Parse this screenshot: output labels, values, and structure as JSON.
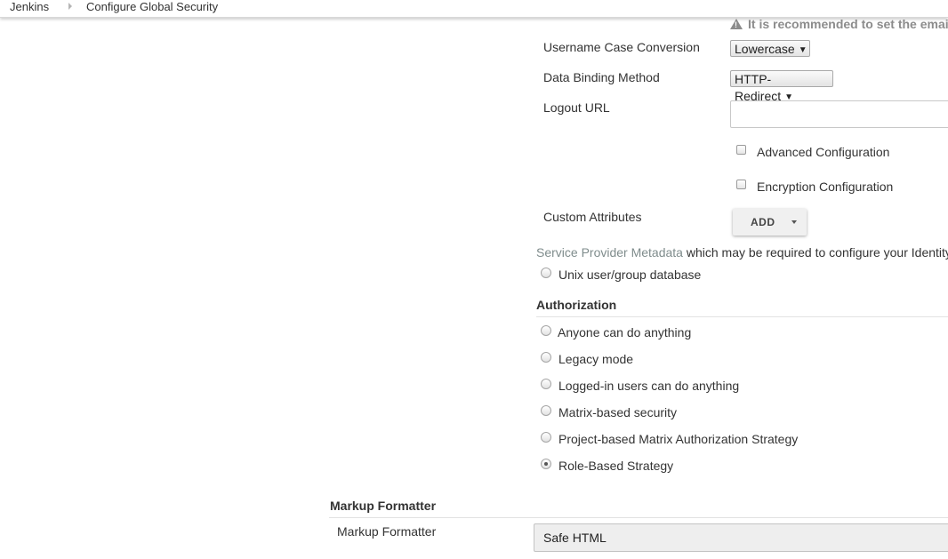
{
  "breadcrumb": {
    "root": "Jenkins",
    "current": "Configure Global Security"
  },
  "saml": {
    "warning": "It is recommended to set the emai",
    "username_case": {
      "label": "Username Case Conversion",
      "value": "Lowercase"
    },
    "binding": {
      "label": "Data Binding Method",
      "value": "HTTP-Redirect"
    },
    "logout_url": {
      "label": "Logout URL",
      "value": "",
      "placeholder": ""
    },
    "advanced_config": {
      "label": "Advanced Configuration",
      "checked": false
    },
    "encryption_config": {
      "label": "Encryption Configuration",
      "checked": false
    },
    "custom_attributes": {
      "label": "Custom Attributes",
      "button": "ADD"
    },
    "metadata": {
      "link": "Service Provider Metadata",
      "text": " which may be required to configure your Identity"
    }
  },
  "security_realm": {
    "unix": "Unix user/group database"
  },
  "authorization": {
    "title": "Authorization",
    "options": [
      {
        "label": "Anyone can do anything",
        "checked": false
      },
      {
        "label": "Legacy mode",
        "checked": false
      },
      {
        "label": "Logged-in users can do anything",
        "checked": false
      },
      {
        "label": "Matrix-based security",
        "checked": false
      },
      {
        "label": "Project-based Matrix Authorization Strategy",
        "checked": false
      },
      {
        "label": "Role-Based Strategy",
        "checked": true
      }
    ]
  },
  "markup_formatter": {
    "section_title": "Markup Formatter",
    "label": "Markup Formatter",
    "value": "Safe HTML"
  },
  "colors": {
    "link": "#7f8c8c",
    "warning": "#8c8c8c",
    "text": "#333333"
  },
  "icons": {
    "breadcrumb_separator": "chevron-right-icon",
    "warning": "warning-icon",
    "select_arrow": "caret-down-icon"
  }
}
